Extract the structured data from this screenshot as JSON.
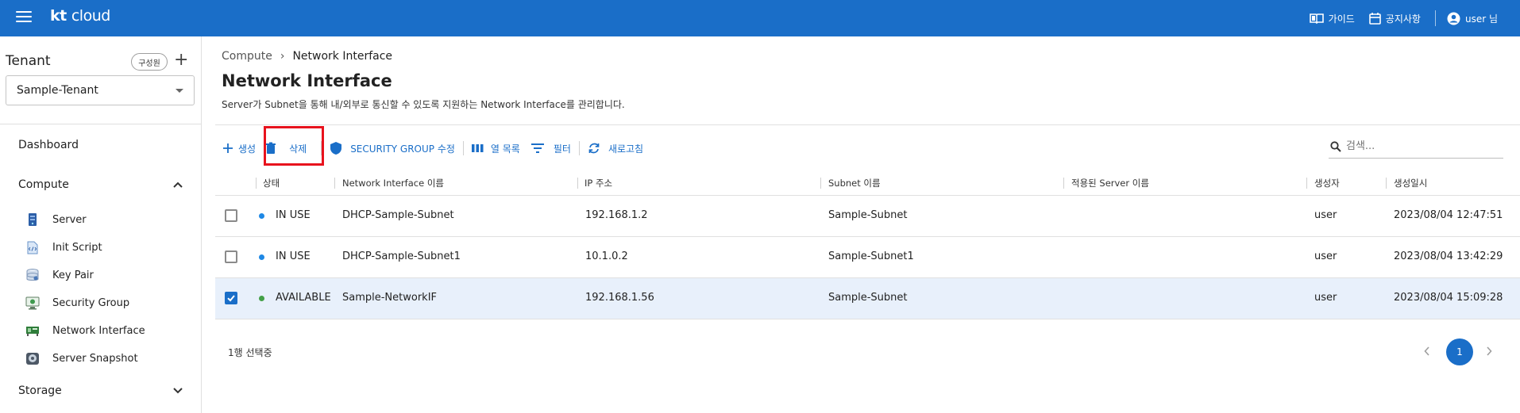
{
  "header": {
    "logo_kt": "kt",
    "logo_cloud": "cloud",
    "guide_label": "가이드",
    "notice_label": "공지사항",
    "user_label": "user 님",
    "brand_color": "#1a6ec8"
  },
  "sidebar": {
    "tenant_title": "Tenant",
    "member_button": "구성원",
    "add_button": "+",
    "tenant_selected": "Sample-Tenant",
    "dashboard": "Dashboard",
    "compute": "Compute",
    "compute_items": [
      {
        "label": "Server",
        "icon": "server-icon"
      },
      {
        "label": "Init Script",
        "icon": "script-icon"
      },
      {
        "label": "Key Pair",
        "icon": "keypair-icon"
      },
      {
        "label": "Security Group",
        "icon": "security-group-icon"
      },
      {
        "label": "Network Interface",
        "icon": "network-card-icon"
      },
      {
        "label": "Server Snapshot",
        "icon": "snapshot-icon"
      }
    ],
    "storage": "Storage"
  },
  "main": {
    "breadcrumb": [
      "Compute",
      "Network Interface"
    ],
    "title": "Network Interface",
    "description": "Server가 Subnet을 통해 내/외부로 통신할 수 있도록 지원하는 Network Interface를 관리합니다.",
    "toolbar": {
      "create": "생성",
      "delete": "삭제",
      "edit_security_group": "SECURITY GROUP 수정",
      "columns": "열 목록",
      "filter": "필터",
      "refresh": "새로고침"
    },
    "search_placeholder": "검색...",
    "table": {
      "headers": [
        "상태",
        "Network Interface 이름",
        "IP 주소",
        "Subnet 이름",
        "적용된 Server 이름",
        "생성자",
        "생성일시"
      ],
      "rows": [
        {
          "checked": false,
          "status": "IN USE",
          "status_color": "#1e88e5",
          "name": "DHCP-Sample-Subnet",
          "ip": "192.168.1.2",
          "subnet": "Sample-Subnet",
          "server": "",
          "creator": "user",
          "created": "2023/08/04 12:47:51"
        },
        {
          "checked": false,
          "status": "IN USE",
          "status_color": "#1e88e5",
          "name": "DHCP-Sample-Subnet1",
          "ip": "10.1.0.2",
          "subnet": "Sample-Subnet1",
          "server": "",
          "creator": "user",
          "created": "2023/08/04 13:42:29"
        },
        {
          "checked": true,
          "status": "AVAILABLE",
          "status_color": "#43a047",
          "name": "Sample-NetworkIF",
          "ip": "192.168.1.56",
          "subnet": "Sample-Subnet",
          "server": "",
          "creator": "user",
          "created": "2023/08/04 15:09:28"
        }
      ]
    },
    "selection_text": "1행 선택중",
    "current_page": "1"
  }
}
